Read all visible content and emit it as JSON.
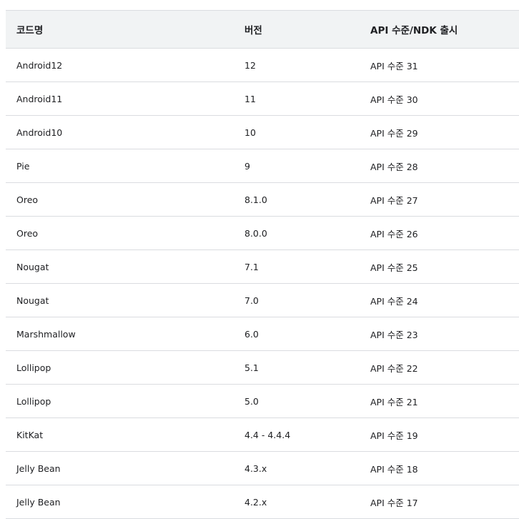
{
  "table": {
    "headers": [
      "코드명",
      "버전",
      "API 수준/NDK 출시"
    ],
    "rows": [
      [
        "Android12",
        "12",
        "API 수준 31"
      ],
      [
        "Android11",
        "11",
        "API 수준 30"
      ],
      [
        "Android10",
        "10",
        "API 수준 29"
      ],
      [
        "Pie",
        "9",
        "API 수준 28"
      ],
      [
        "Oreo",
        "8.1.0",
        "API 수준 27"
      ],
      [
        "Oreo",
        "8.0.0",
        "API 수준 26"
      ],
      [
        "Nougat",
        "7.1",
        "API 수준 25"
      ],
      [
        "Nougat",
        "7.0",
        "API 수준 24"
      ],
      [
        "Marshmallow",
        "6.0",
        "API 수준 23"
      ],
      [
        "Lollipop",
        "5.1",
        "API 수준 22"
      ],
      [
        "Lollipop",
        "5.0",
        "API 수준 21"
      ],
      [
        "KitKat",
        "4.4 - 4.4.4",
        "API 수준 19"
      ],
      [
        "Jelly Bean",
        "4.3.x",
        "API 수준 18"
      ],
      [
        "Jelly Bean",
        "4.2.x",
        "API 수준 17"
      ]
    ]
  },
  "colors": {
    "header_bg": "#f1f3f4",
    "border": "#dadce0",
    "text": "#202124"
  }
}
